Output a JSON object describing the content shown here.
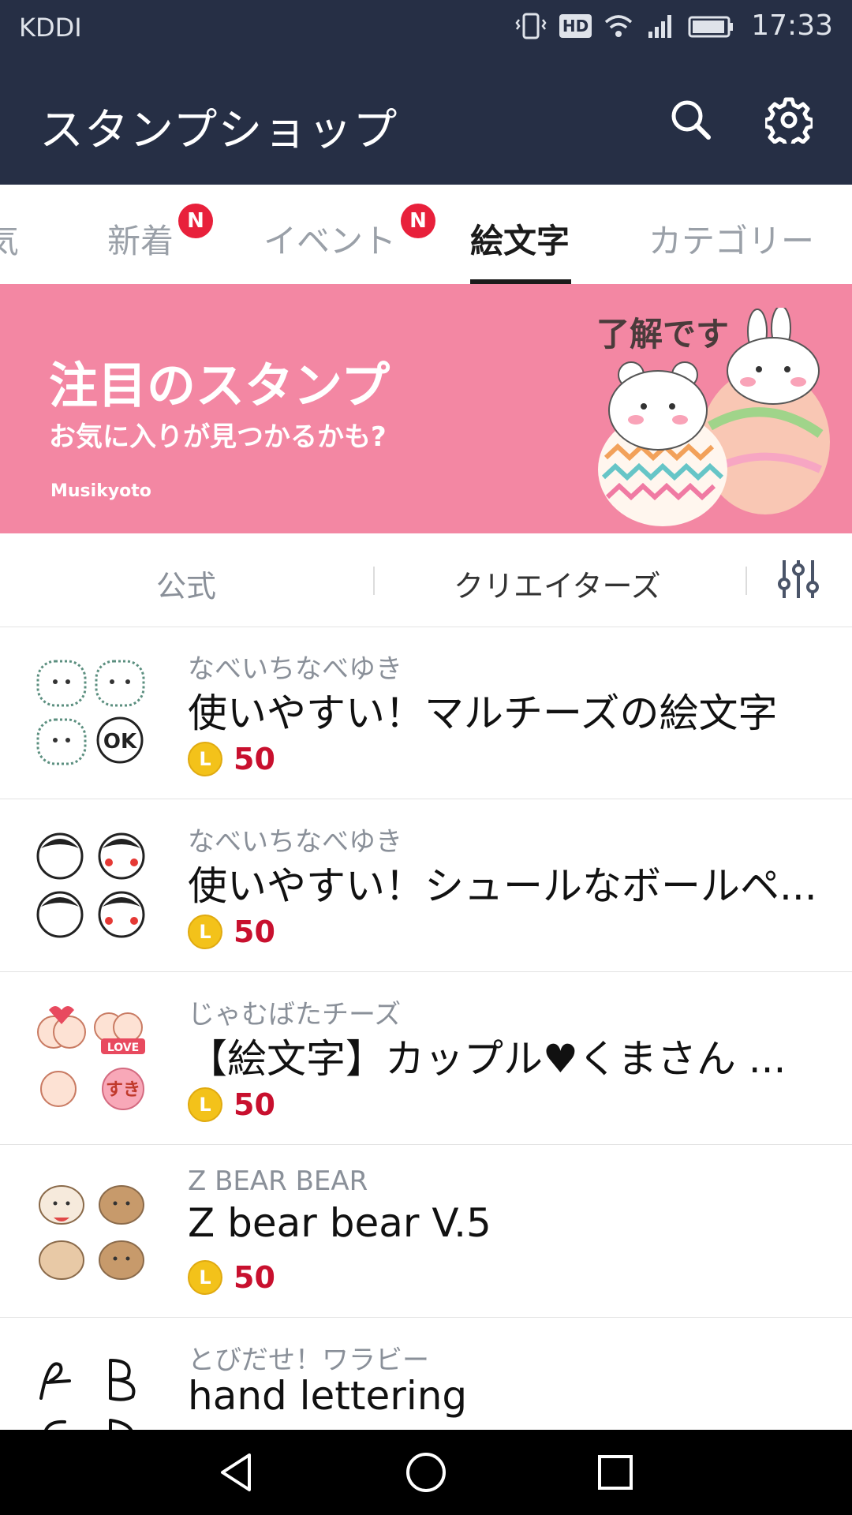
{
  "status_bar": {
    "carrier": "KDDI",
    "hd_label": "HD",
    "time": "17:33"
  },
  "app_bar": {
    "title": "スタンプショップ",
    "search_icon": "search-icon",
    "settings_icon": "gear-icon"
  },
  "tabs": {
    "partial_left": "気",
    "items": [
      {
        "label": "新着",
        "badge": "N"
      },
      {
        "label": "イベント",
        "badge": "N"
      },
      {
        "label": "絵文字",
        "active": true
      },
      {
        "label": "カテゴリー"
      }
    ]
  },
  "banner": {
    "title": "注目のスタンプ",
    "subtitle": "お気に入りが見つかるかも?",
    "credit": "Musikyoto",
    "caption": "了解です",
    "background": "#f387a3"
  },
  "filters": {
    "official": "公式",
    "creators": "クリエイターズ",
    "filter_icon": "sliders-icon"
  },
  "items": [
    {
      "author": "なべいちなべゆき",
      "title": "使いやすい！マルチーズの絵文字",
      "price": "50"
    },
    {
      "author": "なべいちなべゆき",
      "title": "使いやすい！シュールなボールペ...",
      "price": "50"
    },
    {
      "author": "じゃむばたチーズ",
      "title": "【絵文字】カップル♥くまさん ...",
      "price": "50"
    },
    {
      "author": "Z BEAR BEAR",
      "title": "Z bear bear V.5",
      "price": "50"
    },
    {
      "author": "とびだせ！ワラビー",
      "title": "hand lettering",
      "price": ""
    }
  ],
  "coin_label": "L",
  "thumb_text": {
    "ok": "OK",
    "love": "LOVE",
    "suki": "すき"
  },
  "colors": {
    "header": "#262f45",
    "badge": "#e8203b",
    "price": "#c8102e",
    "coin": "#f3c21a"
  },
  "nav": {
    "back_icon": "back-triangle-icon",
    "home_icon": "home-circle-icon",
    "recents_icon": "recents-square-icon"
  }
}
